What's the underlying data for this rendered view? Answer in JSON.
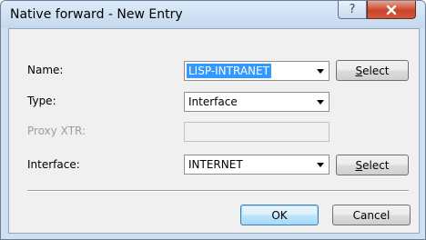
{
  "window": {
    "title": "Native forward - New Entry",
    "help_glyph": "?"
  },
  "form": {
    "name_label": "Name:",
    "name_value": "LISP-INTRANET",
    "name_select_label_u": "S",
    "name_select_label_rest": "elect",
    "type_label": "Type:",
    "type_value": "Interface",
    "proxy_label": "Proxy XTR:",
    "interface_label": "Interface:",
    "interface_value": "INTERNET",
    "interface_select_label_u": "S",
    "interface_select_label_rest": "elect"
  },
  "footer": {
    "ok_label": "OK",
    "cancel_label": "Cancel"
  },
  "colors": {
    "selection": "#3399ff",
    "close_button": "#c7452c"
  },
  "icons": [
    "help-icon",
    "close-icon",
    "dropdown-arrow-icon"
  ]
}
